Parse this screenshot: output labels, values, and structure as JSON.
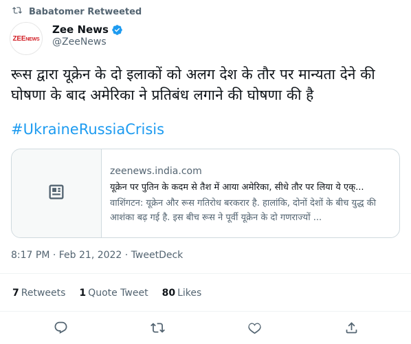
{
  "retweet_bar": {
    "label": "Babatomer Retweeted"
  },
  "author": {
    "name": "Zee News",
    "handle": "@ZeeNews",
    "avatar_text": "ZEE",
    "avatar_text2": "NEWS",
    "verified": true
  },
  "tweet": {
    "text": "रूस द्वारा यूक्रेन के दो इलाकों को अलग देश के तौर पर मान्यता देने की घोषणा के बाद अमेरिका ने प्रतिबंध लगाने की घोषणा की है",
    "hashtag": "#UkraineRussiaCrisis"
  },
  "link_card": {
    "domain": "zeenews.india.com",
    "title": "यूक्रेन पर पुतिन के कदम से तैश में आया अमेरिका, सीधे तौर पर लिया ये एक्...",
    "description": "वाशिंगटन: यूक्रेन और रूस गतिरोध बरकरार है. हालांकि, दोनों देशों के बीच युद्ध की आशंका बढ़ गई है. इस बीच रूस ने पूर्वी यूक्रेन के दो गणराज्यों ..."
  },
  "meta": {
    "timestamp": "8:17 PM · Feb 21, 2022 · TweetDeck"
  },
  "stats": {
    "retweets_count": "7",
    "retweets_label": "Retweets",
    "quotes_count": "1",
    "quotes_label": "Quote Tweet",
    "likes_count": "80",
    "likes_label": "Likes"
  },
  "icons": {
    "retweet": "retweet-icon",
    "verified": "verified-badge-icon",
    "article": "article-icon",
    "reply": "reply-icon",
    "like": "heart-icon",
    "share": "share-icon"
  },
  "colors": {
    "accent": "#1d9bf0",
    "secondary_text": "#536471",
    "brand": "#d21f26"
  }
}
